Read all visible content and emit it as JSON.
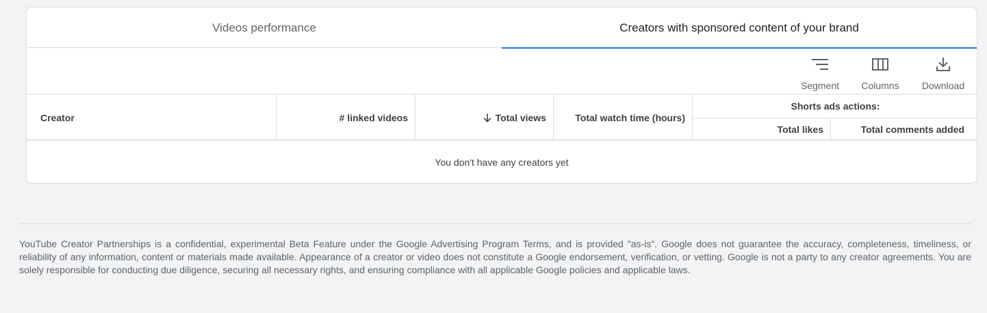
{
  "tabs": [
    {
      "label": "Videos performance",
      "active": false
    },
    {
      "label": "Creators with sponsored content of your brand",
      "active": true
    }
  ],
  "toolbar": {
    "segment_label": "Segment",
    "columns_label": "Columns",
    "download_label": "Download"
  },
  "table": {
    "columns": {
      "creator": "Creator",
      "linked_videos": "# linked videos",
      "total_views": "Total views",
      "total_watch_time": "Total watch time (hours)",
      "shorts_group": "Shorts ads actions:",
      "total_likes": "Total likes",
      "total_comments": "Total comments added"
    },
    "sorted_column": "total_views",
    "sort_direction": "descending",
    "empty_message": "You don't have any creators yet"
  },
  "footer": {
    "disclaimer": "YouTube Creator Partnerships is a confidential, experimental Beta Feature under the Google Advertising Program Terms, and is provided \"as-is\". Google does not guarantee the accuracy, completeness, timeliness, or reliability of any information, content or materials made available. Appearance of a creator or video does not constitute a Google endorsement, verification, or vetting. Google is not a party to any creator agreements. You are solely responsible for conducting due diligence, securing all necessary rights, and ensuring compliance with all applicable Google policies and applicable laws."
  },
  "colors": {
    "accent": "#1a73e8",
    "background": "#f1f3f4",
    "border": "#dadce0",
    "text": "#3c4043"
  }
}
